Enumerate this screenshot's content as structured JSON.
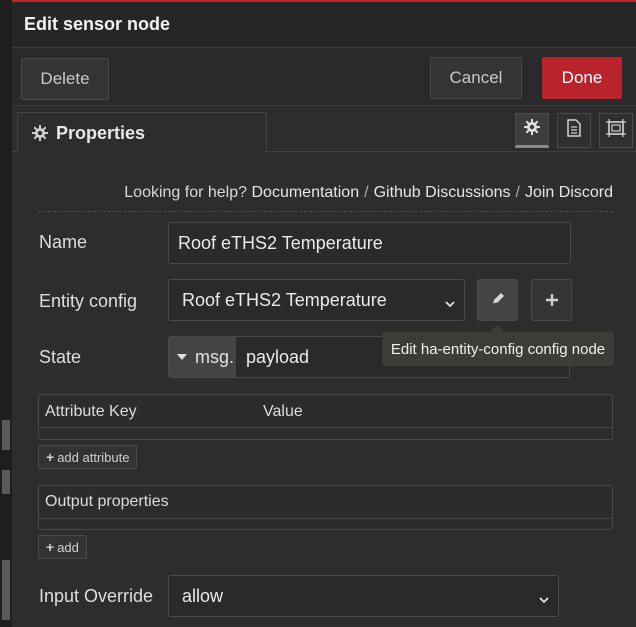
{
  "titlebar": {
    "title": "Edit sensor node"
  },
  "toolbar": {
    "delete_label": "Delete",
    "cancel_label": "Cancel",
    "done_label": "Done"
  },
  "tabs": {
    "properties_label": "Properties",
    "icons": [
      "gear-icon",
      "document-icon",
      "frame-icon"
    ]
  },
  "help": {
    "prefix": "Looking for help?",
    "links": [
      "Documentation",
      "Github Discussions",
      "Join Discord"
    ],
    "separator": "/"
  },
  "form": {
    "name_label": "Name",
    "name_value": "Roof eTHS2 Temperature",
    "entity_config_label": "Entity config",
    "entity_config_value": "Roof eTHS2 Temperature",
    "state_label": "State",
    "state_prefix": "msg.",
    "state_value": "payload",
    "attributes_key_header": "Attribute Key",
    "attributes_value_header": "Value",
    "add_attribute_label": "add attribute",
    "output_properties_header": "Output properties",
    "add_output_label": "add",
    "input_override_label": "Input Override",
    "input_override_value": "allow"
  },
  "tooltip": {
    "text": "Edit ha-entity-config config node"
  },
  "colors": {
    "accent": "#b8232c",
    "background": "#2d2d2d",
    "tooltip_bg": "#3c3d38"
  }
}
